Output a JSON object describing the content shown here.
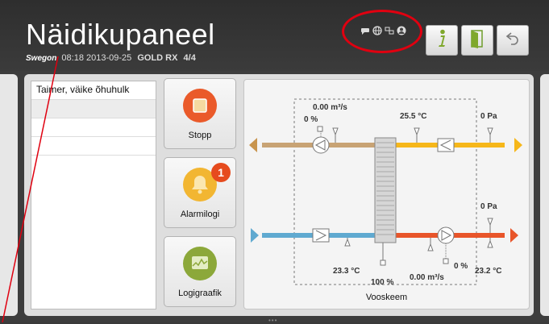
{
  "header": {
    "title": "Näidikupaneel",
    "brand": "Swegon",
    "time": "08:18",
    "date": "2013-09-25",
    "model": "GOLD RX",
    "page": "4/4"
  },
  "header_buttons": [
    {
      "name": "info",
      "icon": "info-icon"
    },
    {
      "name": "exit",
      "icon": "door-icon"
    },
    {
      "name": "back",
      "icon": "back-arrow-icon"
    }
  ],
  "status_icons": [
    "chat-icon",
    "globe-icon",
    "network-icon",
    "user-icon"
  ],
  "list": {
    "items": [
      "Taimer, väike õhuhulk",
      "",
      "",
      ""
    ]
  },
  "tiles": {
    "stop_label": "Stopp",
    "alarm_label": "Alarmilogi",
    "alarm_count": "1",
    "graph_label": "Logigraafik"
  },
  "scheme": {
    "title": "Vooskeem",
    "top_flow": "0.00 m³/s",
    "top_damper": "0 %",
    "top_temp": "25.5 °C",
    "top_pressure": "0 Pa",
    "bottom_pressure": "0 Pa",
    "left_bottom_temp": "23.3 °C",
    "exchanger": "100 %",
    "bottom_flow": "0.00 m³/s",
    "bottom_damper": "0 %",
    "right_bottom_temp": "23.2 °C"
  },
  "colors": {
    "extract": "#c8a374",
    "exhaust_arrow": "#c8944d",
    "supply_warm": "#f6b71a",
    "outdoor": "#5fa9d0",
    "supply": "#e8552a",
    "stop": "#ea5a2a",
    "alarm": "#f2b632",
    "graph": "#8ca83a",
    "annotation": "#e00010"
  }
}
